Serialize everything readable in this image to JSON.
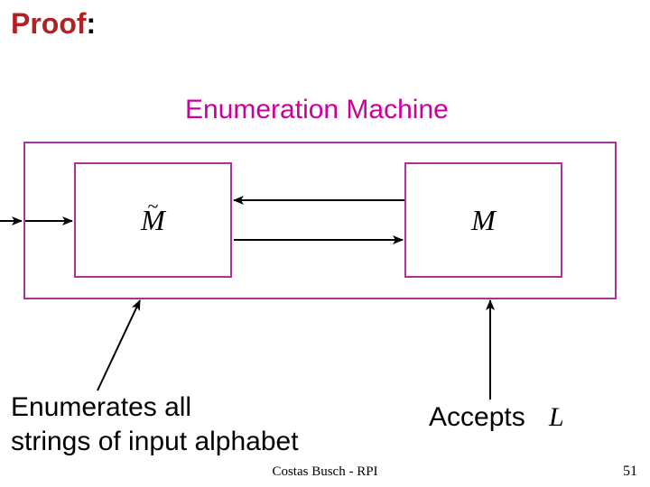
{
  "header": {
    "proof_word": "Proof",
    "colon": ":"
  },
  "title": "Enumeration Machine",
  "boxes": {
    "left": {
      "tilde": "~",
      "letter": "M"
    },
    "right": {
      "letter": "M"
    }
  },
  "captions": {
    "left_line1": "Enumerates all",
    "left_line2": "strings of input alphabet",
    "right": "Accepts",
    "script_L": "L"
  },
  "footer": {
    "center": "Costas Busch - RPI",
    "page": "51"
  }
}
